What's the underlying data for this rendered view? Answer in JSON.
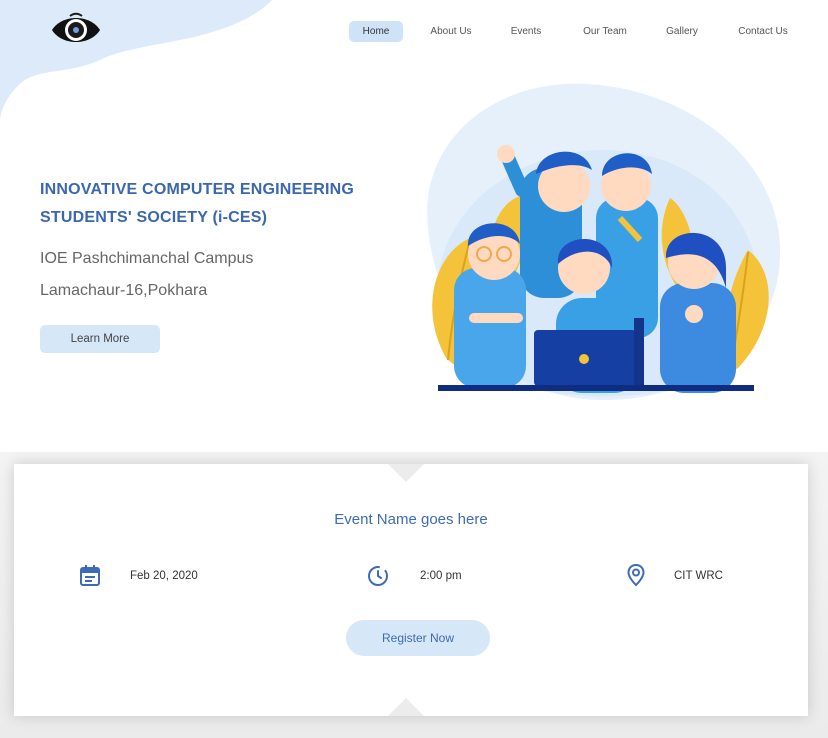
{
  "nav": {
    "items": [
      {
        "label": "Home",
        "active": true
      },
      {
        "label": "About Us",
        "active": false
      },
      {
        "label": "Events",
        "active": false
      },
      {
        "label": "Our Team",
        "active": false
      },
      {
        "label": "Gallery",
        "active": false
      },
      {
        "label": "Contact Us",
        "active": false
      }
    ]
  },
  "hero": {
    "title_line1": "INNOVATIVE COMPUTER ENGINEERING",
    "title_line2": "STUDENTS' SOCIETY  (i-CES)",
    "campus": "IOE Pashchimanchal Campus",
    "address": "Lamachaur-16,Pokhara",
    "learn_more_label": "Learn More"
  },
  "event": {
    "name": "Event Name goes here",
    "date": "Feb 20, 2020",
    "time": "2:00 pm",
    "location": "CIT WRC",
    "register_label": "Register Now"
  },
  "colors": {
    "accent": "#3d6bb8",
    "button_bg": "#d6e7f8",
    "blob": "#dceaf9"
  },
  "icons": {
    "logo": "eye-logo-icon",
    "date": "calendar-icon",
    "time": "clock-icon",
    "location": "location-pin-icon"
  }
}
